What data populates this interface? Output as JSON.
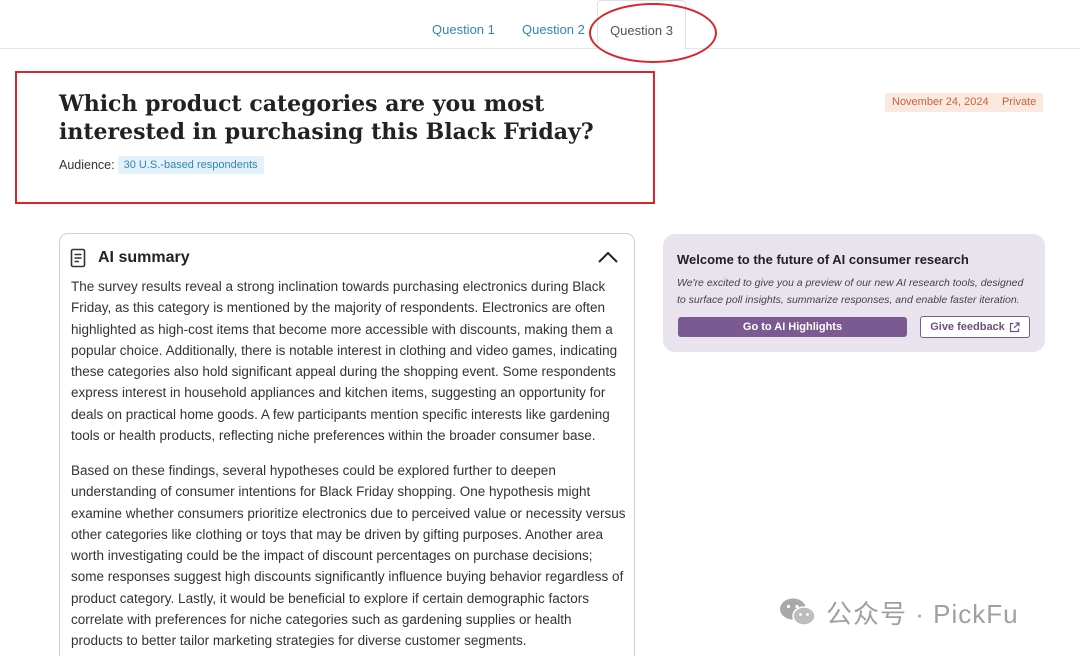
{
  "tabs": [
    {
      "label": "Question 1"
    },
    {
      "label": "Question 2"
    },
    {
      "label": "Question 3"
    }
  ],
  "header": {
    "title": "Which product categories are you most interested in purchasing this Black Friday?",
    "audience_label": "Audience:",
    "audience_value": "30 U.S.-based respondents",
    "date": "November 24, 2024",
    "visibility": "Private"
  },
  "summary": {
    "icon": "document-icon",
    "title": "AI summary",
    "collapse_icon": "chevron-up-icon",
    "paragraphs": [
      "The survey results reveal a strong inclination towards purchasing electronics during Black Friday, as this category is mentioned by the majority of respondents. Electronics are often highlighted as high-cost items that become more accessible with discounts, making them a popular choice. Additionally, there is notable interest in clothing and video games, indicating these categories also hold significant appeal during the shopping event. Some respondents express interest in household appliances and kitchen items, suggesting an opportunity for deals on practical home goods. A few participants mention specific interests like gardening tools or health products, reflecting niche preferences within the broader consumer base.",
      "Based on these findings, several hypotheses could be explored further to deepen understanding of consumer intentions for Black Friday shopping. One hypothesis might examine whether consumers prioritize electronics due to perceived value or necessity versus other categories like clothing or toys that may be driven by gifting purposes. Another area worth investigating could be the impact of discount percentages on purchase decisions; some responses suggest high discounts significantly influence buying behavior regardless of product category. Lastly, it would be beneficial to explore if certain demographic factors correlate with preferences for niche categories such as gardening supplies or health products to better tailor marketing strategies for diverse customer segments."
    ]
  },
  "promo": {
    "title": "Welcome to the future of AI consumer research",
    "text": "We're excited to give you a preview of our new AI research tools, designed to surface poll insights, summarize responses, and enable faster iteration.",
    "primary_button": "Go to AI Highlights",
    "secondary_button": "Give feedback",
    "secondary_icon": "external-link-icon"
  },
  "watermark": {
    "icon": "wechat-icon",
    "text": "公众号 · PickFu"
  },
  "colors": {
    "tab_link": "#2f86b8",
    "annotation_red": "#d7262c",
    "chip_orange_bg": "#fbe8df",
    "chip_orange_text": "#c9643a",
    "audience_chip_bg": "#e4f1fa",
    "promo_bg": "#e9e3ee",
    "promo_button": "#7a5a90"
  }
}
